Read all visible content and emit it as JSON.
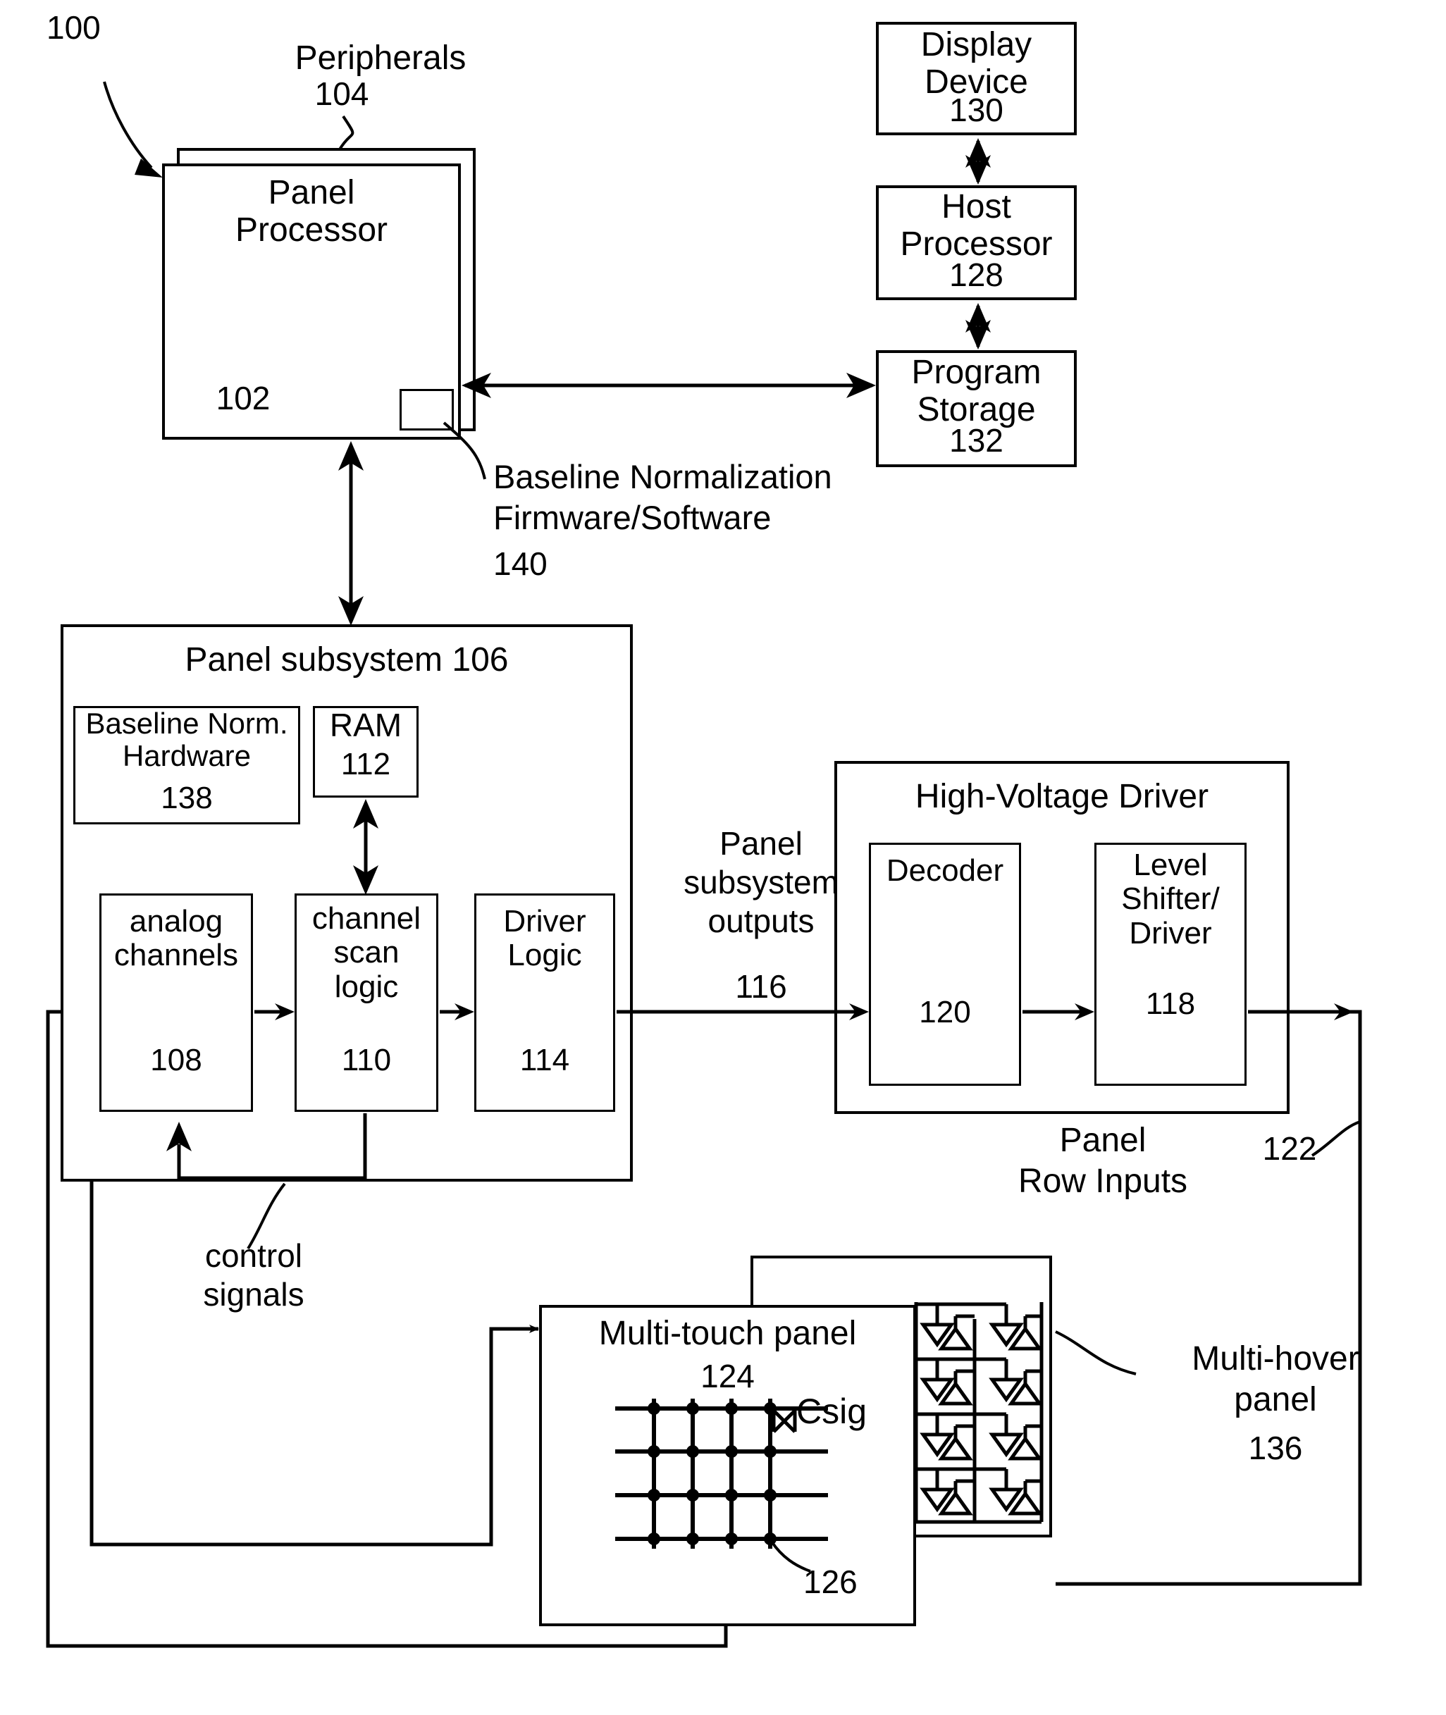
{
  "figure": {
    "number": "100",
    "type": "patent-block-diagram"
  },
  "labels": {
    "peripherals": "Peripherals",
    "peripherals_num": "104",
    "panel_processor": "Panel\nProcessor",
    "panel_processor_num": "102",
    "baseline_norm_fw": "Baseline Normalization\nFirmware/Software",
    "baseline_norm_fw_num": "140",
    "display_device": "Display\nDevice",
    "display_device_num": "130",
    "host_processor": "Host\nProcessor",
    "host_processor_num": "128",
    "program_storage": "Program\nStorage",
    "program_storage_num": "132",
    "panel_subsystem": "Panel subsystem 106",
    "baseline_norm_hw": "Baseline Norm.\nHardware",
    "baseline_norm_hw_num": "138",
    "ram": "RAM",
    "ram_num": "112",
    "analog_channels": "analog\nchannels",
    "analog_channels_num": "108",
    "channel_scan_logic": "channel\nscan\nlogic",
    "channel_scan_logic_num": "110",
    "driver_logic": "Driver\nLogic",
    "driver_logic_num": "114",
    "panel_subsystem_outputs": "Panel\nsubsystem\noutputs",
    "panel_subsystem_outputs_num": "116",
    "high_voltage_driver": "High-Voltage Driver",
    "decoder": "Decoder",
    "decoder_num": "120",
    "level_shifter_driver": "Level\nShifter/\nDriver",
    "level_shifter_driver_num": "118",
    "panel_row_inputs": "Panel\nRow Inputs",
    "panel_row_inputs_num": "122",
    "control_signals": "control\nsignals",
    "multi_touch_panel": "Multi-touch panel",
    "multi_touch_panel_num": "124",
    "csig": "Csig",
    "pixel_num": "126",
    "multi_hover_panel": "Multi-hover\npanel",
    "multi_hover_panel_num": "136"
  },
  "touch_grid": {
    "rows": 4,
    "columns": 4,
    "node_count": 16
  },
  "hover_array": {
    "rows": 4,
    "columns": 2,
    "cell_symbols": [
      "down-triangle",
      "up-triangle"
    ]
  },
  "colors": {
    "ink": "#000000",
    "paper": "#ffffff"
  }
}
